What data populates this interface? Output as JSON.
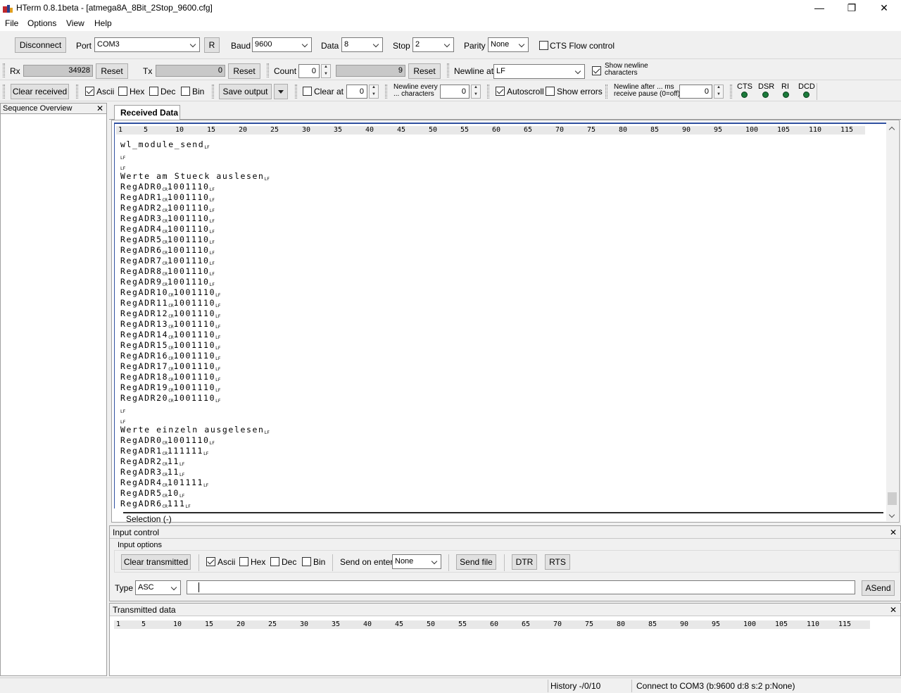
{
  "window": {
    "title": "HTerm 0.8.1beta - [atmega8A_8Bit_2Stop_9600.cfg]",
    "minimize_glyph": "—",
    "restore_glyph": "❐",
    "close_glyph": "✕"
  },
  "menu": [
    "File",
    "Options",
    "View",
    "Help"
  ],
  "connection": {
    "disconnect_label": "Disconnect",
    "port_label": "Port",
    "port_value": "COM3",
    "refresh_label": "R",
    "baud_label": "Baud",
    "baud_value": "9600",
    "data_label": "Data",
    "data_value": "8",
    "stop_label": "Stop",
    "stop_value": "2",
    "parity_label": "Parity",
    "parity_value": "None",
    "cts_label": "CTS Flow control"
  },
  "counters": {
    "rx_label": "Rx",
    "rx_value": "34928",
    "rx_reset": "Reset",
    "tx_label": "Tx",
    "tx_value": "0",
    "tx_reset": "Reset",
    "count_label": "Count",
    "count_value": "0",
    "count_total": "9",
    "count_reset": "Reset",
    "newline_at_label": "Newline at",
    "newline_at_value": "LF",
    "show_newline_line1": "Show newline",
    "show_newline_line2": "characters"
  },
  "receive_options": {
    "clear_received": "Clear received",
    "ascii": "Ascii",
    "hex": "Hex",
    "dec": "Dec",
    "bin": "Bin",
    "save_output": "Save output",
    "clear_at": "Clear at",
    "clear_at_value": "0",
    "newline_every_line1": "Newline every",
    "newline_every_line2": "... characters",
    "newline_every_value": "0",
    "autoscroll": "Autoscroll",
    "show_errors": "Show errors",
    "newline_after_line1": "Newline after ... ms",
    "newline_after_line2": "receive pause (0=off)",
    "newline_after_value": "0",
    "signals": [
      "CTS",
      "DSR",
      "RI",
      "DCD"
    ]
  },
  "sequence_overview": {
    "title": "Sequence Overview",
    "close": "✕"
  },
  "received_tab": "Received Data",
  "ruler": [
    "1",
    "5",
    "10",
    "15",
    "20",
    "25",
    "30",
    "35",
    "40",
    "45",
    "50",
    "55",
    "60",
    "65",
    "70",
    "75",
    "80",
    "85",
    "90",
    "95",
    "100",
    "105",
    "110",
    "115"
  ],
  "received_lines": [
    [
      "wl_module_send",
      "LF"
    ],
    [
      "",
      "LF"
    ],
    [
      "",
      "LF"
    ],
    [
      "Werte am Stueck auslesen",
      "LF"
    ],
    [
      "RegADR0",
      "CR",
      "1001110",
      "LF"
    ],
    [
      "RegADR1",
      "CR",
      "1001110",
      "LF"
    ],
    [
      "RegADR2",
      "CR",
      "1001110",
      "LF"
    ],
    [
      "RegADR3",
      "CR",
      "1001110",
      "LF"
    ],
    [
      "RegADR4",
      "CR",
      "1001110",
      "LF"
    ],
    [
      "RegADR5",
      "CR",
      "1001110",
      "LF"
    ],
    [
      "RegADR6",
      "CR",
      "1001110",
      "LF"
    ],
    [
      "RegADR7",
      "CR",
      "1001110",
      "LF"
    ],
    [
      "RegADR8",
      "CR",
      "1001110",
      "LF"
    ],
    [
      "RegADR9",
      "CR",
      "1001110",
      "LF"
    ],
    [
      "RegADR10",
      "CR",
      "1001110",
      "LF"
    ],
    [
      "RegADR11",
      "CR",
      "1001110",
      "LF"
    ],
    [
      "RegADR12",
      "CR",
      "1001110",
      "LF"
    ],
    [
      "RegADR13",
      "CR",
      "1001110",
      "LF"
    ],
    [
      "RegADR14",
      "CR",
      "1001110",
      "LF"
    ],
    [
      "RegADR15",
      "CR",
      "1001110",
      "LF"
    ],
    [
      "RegADR16",
      "CR",
      "1001110",
      "LF"
    ],
    [
      "RegADR17",
      "CR",
      "1001110",
      "LF"
    ],
    [
      "RegADR18",
      "CR",
      "1001110",
      "LF"
    ],
    [
      "RegADR19",
      "CR",
      "1001110",
      "LF"
    ],
    [
      "RegADR20",
      "CR",
      "1001110",
      "LF"
    ],
    [
      "",
      "LF"
    ],
    [
      "",
      "LF"
    ],
    [
      "Werte einzeln ausgelesen",
      "LF"
    ],
    [
      "RegADR0",
      "CR",
      "1001110",
      "LF"
    ],
    [
      "RegADR1",
      "CR",
      "111111",
      "LF"
    ],
    [
      "RegADR2",
      "CR",
      "11",
      "LF"
    ],
    [
      "RegADR3",
      "CR",
      "11",
      "LF"
    ],
    [
      "RegADR4",
      "CR",
      "101111",
      "LF"
    ],
    [
      "RegADR5",
      "CR",
      "10",
      "LF"
    ],
    [
      "RegADR6",
      "CR",
      "111",
      "LF"
    ]
  ],
  "selection_label": "Selection (-)",
  "input_control": {
    "title": "Input control",
    "options_label": "Input options",
    "clear_transmitted": "Clear transmitted",
    "ascii": "Ascii",
    "hex": "Hex",
    "dec": "Dec",
    "bin": "Bin",
    "send_on_enter_label": "Send on enter",
    "send_on_enter_value": "None",
    "send_file": "Send file",
    "dtr": "DTR",
    "rts": "RTS",
    "type_label": "Type",
    "type_value": "ASC",
    "input_value": "",
    "asend": "ASend"
  },
  "transmitted": {
    "title": "Transmitted data"
  },
  "status": {
    "history": "History -/0/10",
    "connection": "Connect to COM3 (b:9600 d:8 s:2 p:None)"
  },
  "colors": {
    "led": "#1a7a3a",
    "selection_border": "#3050a0"
  }
}
